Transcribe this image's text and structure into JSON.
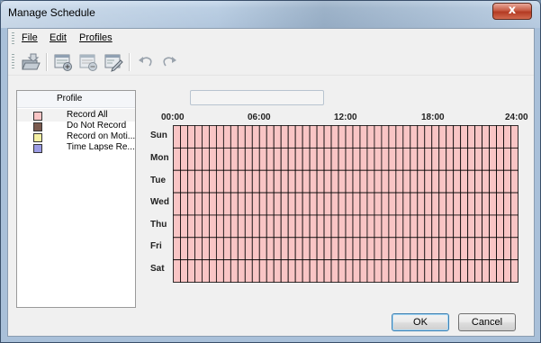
{
  "window": {
    "title": "Manage Schedule",
    "close_glyph": "x"
  },
  "menu": {
    "items": [
      {
        "label": "File"
      },
      {
        "label": "Edit"
      },
      {
        "label": "Profiles"
      }
    ]
  },
  "toolbar": {
    "icons": [
      "open-folder-icon",
      "add-schedule-icon",
      "remove-schedule-icon",
      "edit-schedule-icon",
      "undo-icon",
      "redo-icon"
    ]
  },
  "profiles": {
    "header": "Profile",
    "items": [
      {
        "label": "Record All",
        "color": "#f9c5c5",
        "selected": true
      },
      {
        "label": "Do Not Record",
        "color": "#7a5a4e",
        "selected": false
      },
      {
        "label": "Record on Moti...",
        "color": "#f4f0a4",
        "selected": false
      },
      {
        "label": "Time Lapse Re...",
        "color": "#9c9ce4",
        "selected": false
      }
    ]
  },
  "schedule": {
    "name_value": "",
    "time_labels": [
      "00:00",
      "06:00",
      "12:00",
      "18:00",
      "24:00"
    ],
    "days": [
      "Sun",
      "Mon",
      "Tue",
      "Wed",
      "Thu",
      "Fri",
      "Sat"
    ],
    "slots_per_day": 48,
    "fill_color": "#f9c5c5",
    "line_color": "#000000"
  },
  "buttons": {
    "ok": "OK",
    "cancel": "Cancel"
  }
}
